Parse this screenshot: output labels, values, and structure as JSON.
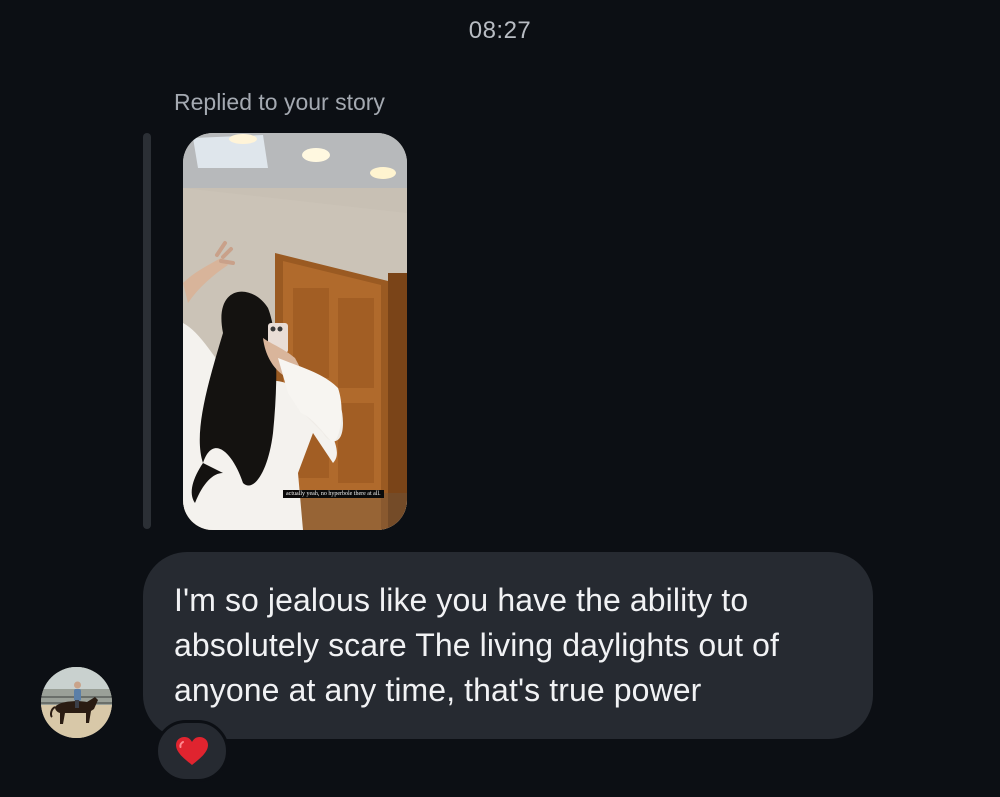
{
  "thread": {
    "timestamp": "08:27"
  },
  "story_reply": {
    "label": "Replied to your story",
    "story_caption": "actually yeah, no hyperbole there at all."
  },
  "message": {
    "text": "I'm so jealous like you have the ability to absolutely scare The living daylights out of anyone at any time, that's true power"
  },
  "reaction": {
    "icon": "heart-icon",
    "color": "#e0242f"
  },
  "sender": {
    "avatar_icon": "avatar-horse-rider"
  },
  "colors": {
    "background": "#0c0f14",
    "bubble": "#262a31",
    "reply_bar": "#2b2f35",
    "muted_text": "#a4a9b1"
  }
}
